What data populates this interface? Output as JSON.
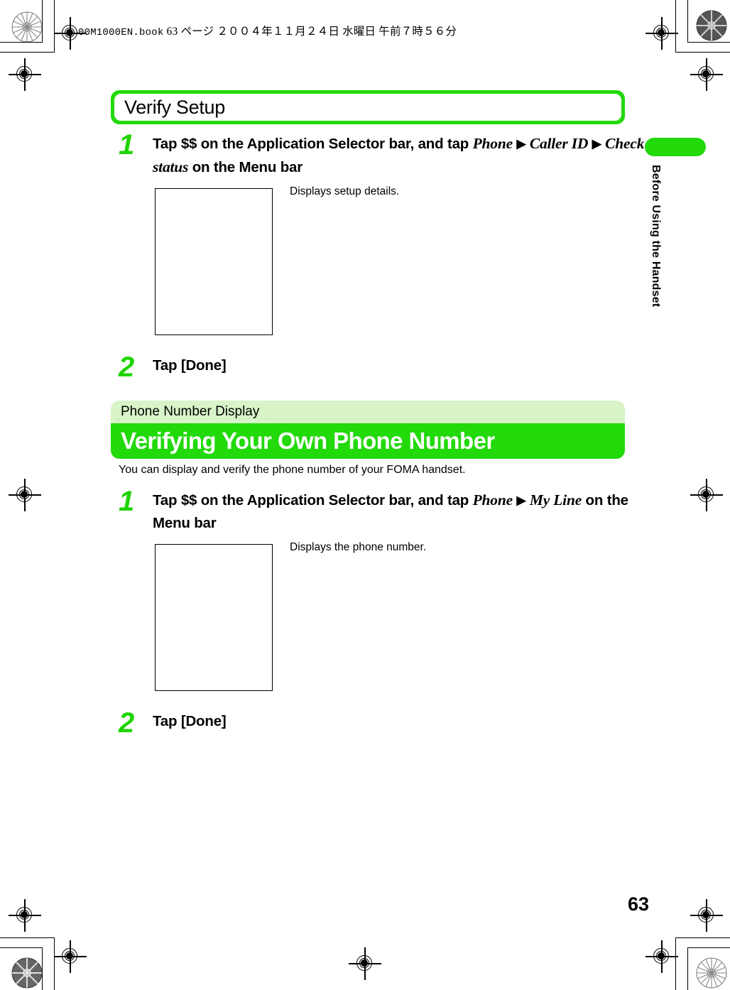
{
  "page": {
    "file_header": "00M1000EN.book   63 ページ   ２００４年１１月２４日   水曜日   午前７時５６分",
    "file_header_name": "00M1000EN.book",
    "file_header_rest": "63 ページ   ２００４年１１月２４日   水曜日   午前７時５６分",
    "folio": "63"
  },
  "sidebar": {
    "chapter_label": "Before Using the Handset"
  },
  "title_box": {
    "label": "Verify Setup"
  },
  "verify_setup": {
    "steps": [
      {
        "number": "1",
        "text_lead": "Tap $$ on the Application Selector bar, and tap ",
        "emph1": "Phone",
        "arrow": "▶",
        "emph2": "Caller ID",
        "arrow2": "▶",
        "emph3": "Check status",
        "text_tail": " on the Menu bar"
      },
      {
        "number": "2",
        "text_lead": "Tap [Done]"
      }
    ],
    "shot_caption": "Displays setup details."
  },
  "section": {
    "eyebrow": "Phone Number Display",
    "heading": "Verifying Your Own Phone Number",
    "intro": "You can display and verify the phone number of your FOMA handset.",
    "steps": [
      {
        "number": "1",
        "text_lead": "Tap $$ on the Application Selector bar, and tap ",
        "emph1": "Phone",
        "arrow": "▶",
        "emph2": "My Line",
        "text_tail": " on the Menu bar"
      },
      {
        "number": "2",
        "text_lead": "Tap [Done]"
      }
    ],
    "shot_caption": "Displays the phone number."
  },
  "colors": {
    "brand_green": "#22d90a",
    "pale_green": "#d8f4c8",
    "step_number_green": "#1fd400"
  }
}
